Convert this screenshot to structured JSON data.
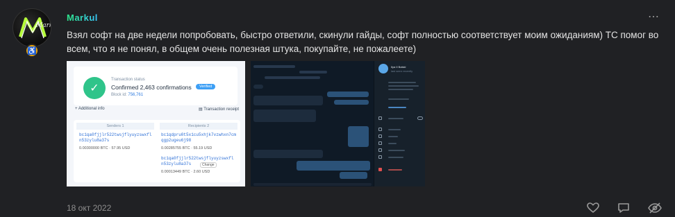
{
  "post": {
    "username": "Markul",
    "avatar_text": "Markul",
    "more_icon": "⋯",
    "badge_icon": "♿",
    "text": "Взял софт на две недели попробовать, быстро ответили, скинули гайды, софт полностью соответствует моим ожиданиям) ТС помог во всем, что я не понял, в общем очень полезная штука, покупайте, не пожалеете)",
    "date": "18 окт 2022"
  },
  "attachment_1": {
    "status_label": "Transaction status",
    "status_text": "Confirmed",
    "confirmations": "2,463 confirmations",
    "pill": "Verified",
    "block_label": "Block id",
    "block_id": "756,761",
    "additional_info": "Additional info",
    "receipt": "Transaction receipt",
    "senders_header": "Senders",
    "senders_count": "1",
    "recipients_header": "Recipients",
    "recipients_count": "2",
    "sender_addr": "bc1qa0fjjlr522twsjflyuyzswxfl n53zylu8a37s",
    "sender_value": "0.00300000 BTC · 57.95 USD",
    "recipient1_addr": "bc1qdpru0t5x1cu5xhjk7vzwhxn7cm qgp2ugeu6j98",
    "recipient1_value": "0.00285755 BTC · 55.19 USD",
    "recipient2_addr": "bc1qa0fjjlr522twsjflyuyzswxfl n53zylu8a37s",
    "recipient2_change": "Change",
    "recipient2_value": "0.00013449 BTC · 2.60 USD"
  },
  "attachment_2": {
    "contact_name": "Ilya II Balski",
    "contact_status": "last seen recently"
  },
  "actions": {
    "like_icon": "heart-icon",
    "reply_icon": "comment-icon",
    "hide_icon": "hide-icon"
  }
}
